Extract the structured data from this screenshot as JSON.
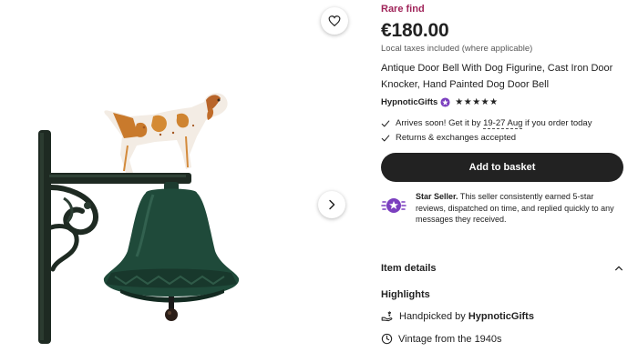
{
  "product": {
    "badge": "Rare find",
    "price": "€180.00",
    "tax_note": "Local taxes included (where applicable)",
    "title": "Antique Door Bell With Dog Figurine, Cast Iron Door Knocker, Hand Painted Dog Door Bell"
  },
  "shop": {
    "name": "HypnoticGifts",
    "stars": "★★★★★"
  },
  "delivery": {
    "prefix": "Arrives soon! Get it by ",
    "date_range": "19-27 Aug",
    "suffix": " if you order today",
    "returns": "Returns & exchanges accepted"
  },
  "actions": {
    "add_to_basket": "Add to basket"
  },
  "star_seller": {
    "title": "Star Seller.",
    "body": " This seller consistently earned 5-star reviews, dispatched on time, and replied quickly to any messages they received."
  },
  "details": {
    "item_details": "Item details",
    "highlights": "Highlights",
    "handpicked_prefix": "Handpicked by ",
    "handpicked_shop": "HypnoticGifts",
    "vintage": "Vintage from the 1940s"
  },
  "icons": {
    "favorite": "heart-icon",
    "next": "chevron-right-icon",
    "check": "check-icon",
    "star_seller": "star-seller-badge-icon",
    "collapse": "chevron-up-icon",
    "handpicked": "hand-icon",
    "vintage": "clock-icon"
  },
  "colors": {
    "badge": "#a0255a",
    "button": "#222222",
    "star_seller_badge": "#7b3fbf"
  }
}
